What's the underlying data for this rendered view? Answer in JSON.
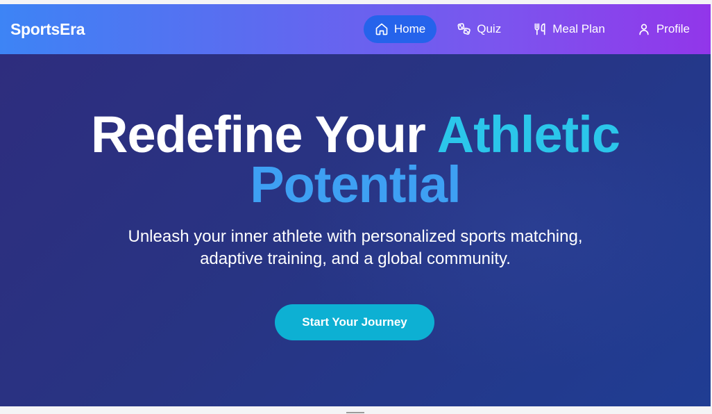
{
  "brand": {
    "name": "SportsEra"
  },
  "nav": {
    "items": [
      {
        "label": "Home",
        "icon": "home-icon",
        "active": true
      },
      {
        "label": "Quiz",
        "icon": "quiz-icon",
        "active": false
      },
      {
        "label": "Meal Plan",
        "icon": "utensils-icon",
        "active": false
      },
      {
        "label": "Profile",
        "icon": "user-icon",
        "active": false
      }
    ]
  },
  "hero": {
    "title_part1": "Redefine Your ",
    "title_part2": "Athletic",
    "title_part3": "Potential",
    "subtitle_line1": "Unleash your inner athlete with personalized sports matching,",
    "subtitle_line2": "adaptive training, and a global community.",
    "cta_label": "Start Your Journey"
  },
  "colors": {
    "nav_gradient_start": "#3d84f5",
    "nav_gradient_end": "#9236ea",
    "active_pill": "#2563eb",
    "hero_bg": "#283483",
    "accent_cyan": "#2bc6ea",
    "accent_blue": "#3ea0f3",
    "cta": "#0db0d3"
  }
}
